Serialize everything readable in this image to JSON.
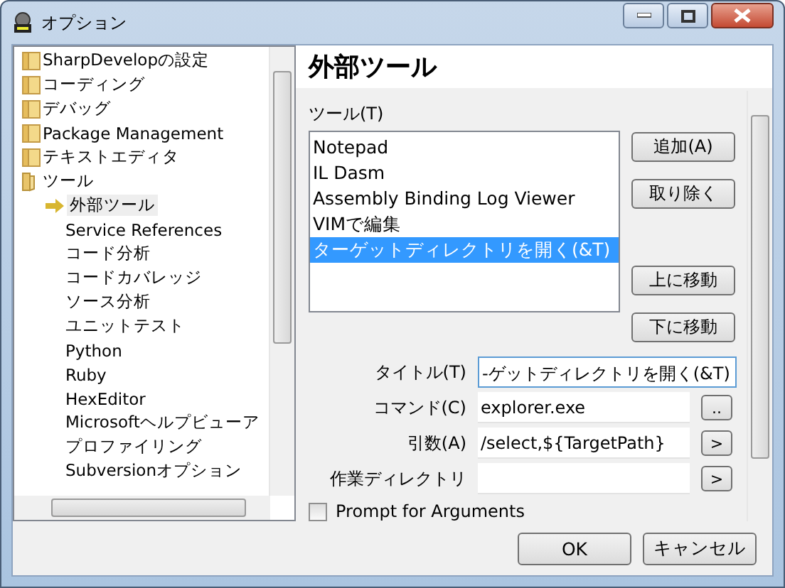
{
  "window": {
    "title": "オプション"
  },
  "tree": [
    {
      "label": "SharpDevelopの設定",
      "expanded": false
    },
    {
      "label": "コーディング",
      "expanded": false
    },
    {
      "label": "デバッグ",
      "expanded": false
    },
    {
      "label": "Package Management",
      "expanded": false
    },
    {
      "label": "テキストエディタ",
      "expanded": false
    },
    {
      "label": "ツール",
      "expanded": true,
      "children": [
        {
          "label": "外部ツール",
          "selected": true
        },
        {
          "label": "Service References",
          "selected": false
        },
        {
          "label": "コード分析",
          "selected": false
        },
        {
          "label": "コードカバレッジ",
          "selected": false
        },
        {
          "label": "ソース分析",
          "selected": false
        },
        {
          "label": "ユニットテスト",
          "selected": false
        },
        {
          "label": "Python",
          "selected": false
        },
        {
          "label": "Ruby",
          "selected": false
        },
        {
          "label": "HexEditor",
          "selected": false
        },
        {
          "label": "Microsoftヘルプビューア",
          "selected": false
        },
        {
          "label": "プロファイリング",
          "selected": false
        },
        {
          "label": "Subversionオプション",
          "selected": false
        }
      ]
    }
  ],
  "panel": {
    "title": "外部ツール",
    "tools_label": "ツール(T)",
    "tools": [
      {
        "label": "Notepad",
        "selected": false
      },
      {
        "label": "IL Dasm",
        "selected": false
      },
      {
        "label": "Assembly Binding Log Viewer",
        "selected": false
      },
      {
        "label": "VIMで編集",
        "selected": false
      },
      {
        "label": "ターゲットディレクトリを開く(&T)",
        "selected": true
      }
    ],
    "side_buttons": [
      "追加(A)",
      "取り除く",
      "上に移動",
      "下に移動"
    ],
    "fields": [
      {
        "label": "タイトル(T)",
        "value": "-ゲットディレクトリを開く(&T)"
      },
      {
        "label": "コマンド(C)",
        "value": "explorer.exe",
        "button": ".."
      },
      {
        "label": "引数(A)",
        "value": "/select,${TargetPath}",
        "button": ">"
      },
      {
        "label": "作業ディレクトリ",
        "button": ">"
      }
    ],
    "prompt": {
      "label": "Prompt for Arguments",
      "checked": false
    }
  },
  "buttons": [
    "OK",
    "キャンセル"
  ]
}
